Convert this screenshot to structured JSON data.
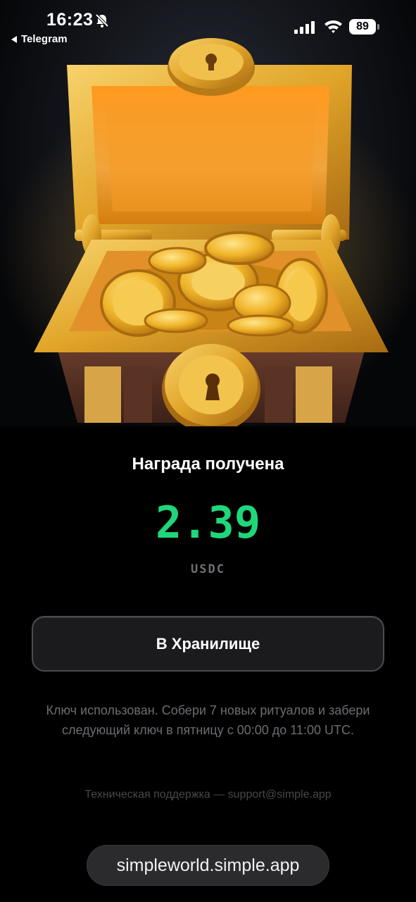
{
  "status_bar": {
    "time": "16:23",
    "back_app": "Telegram",
    "battery": "89",
    "icons": [
      "bell-slash-icon",
      "signal-icon",
      "wifi-icon",
      "battery-icon"
    ]
  },
  "hero": {
    "image": "treasure-chest-with-gold-coins",
    "accent_color": "#f2a81c"
  },
  "reward": {
    "title": "Награда получена",
    "amount": "2.39",
    "currency": "USDC",
    "amount_color": "#1fd67a"
  },
  "vault_button": {
    "label": "В Хранилище"
  },
  "info": {
    "text": "Ключ использован. Собери 7 новых ритуалов и забери следующий ключ в пятницу с 00:00 до 11:00 UTC."
  },
  "support": {
    "text": "Техническая поддержка — support@simple.app"
  },
  "browser": {
    "url": "simpleworld.simple.app"
  }
}
